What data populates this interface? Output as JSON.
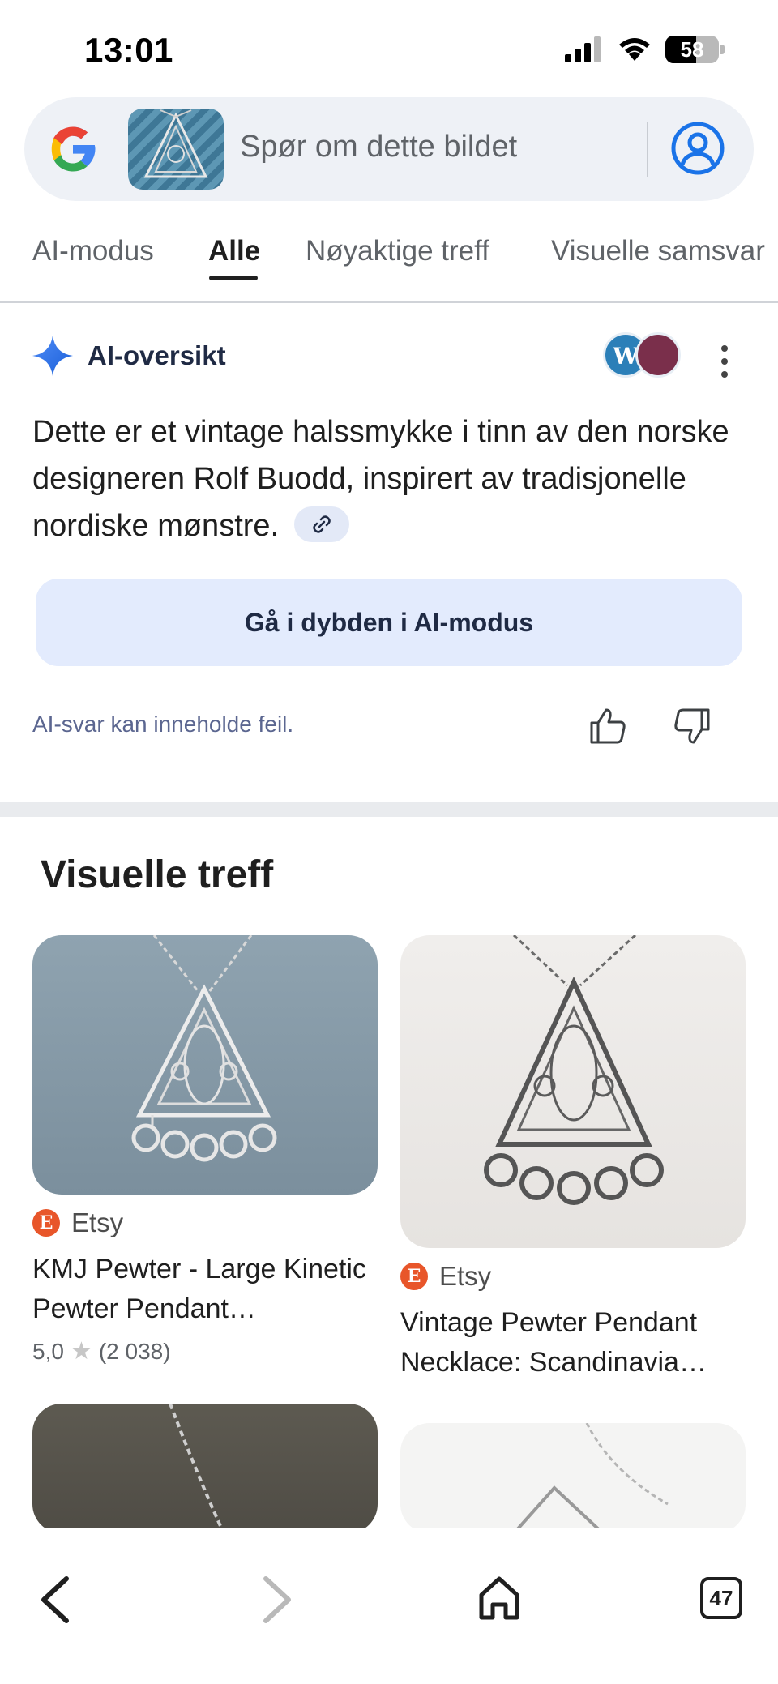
{
  "status_bar": {
    "time": "13:01",
    "battery": "58"
  },
  "search": {
    "placeholder": "Spør om dette bildet"
  },
  "tabs": [
    {
      "label": "AI-modus"
    },
    {
      "label": "Alle",
      "active": true
    },
    {
      "label": "Nøyaktige treff"
    },
    {
      "label": "Visuelle samsvar"
    }
  ],
  "ai_overview": {
    "title": "AI-oversikt",
    "text": "Dette er et vintage halssmykke i tinn av den norske designeren Rolf Buodd, inspirert av tradisjonelle nordiske mønstre.",
    "deep_dive_label": "Gå i dybden i AI-modus",
    "disclaimer": "AI-svar kan inneholde feil.",
    "source_avatar_letter": "W"
  },
  "visual_matches": {
    "title": "Visuelle treff",
    "cards": [
      {
        "source": "Etsy",
        "source_icon_letter": "E",
        "title": "KMJ Pewter - Large Kinetic Pewter Pendant…",
        "rating": "5,0",
        "reviews": "(2 038)"
      },
      {
        "source": "Etsy",
        "source_icon_letter": "E",
        "title": "Vintage Pewter Pendant Necklace: Scandinavia…"
      }
    ]
  },
  "bottom_bar": {
    "tab_count": "47"
  },
  "colors": {
    "google_blue": "#1a73e8",
    "etsy_orange": "#e8562a",
    "deep_dive_bg": "#e3ebfd"
  }
}
